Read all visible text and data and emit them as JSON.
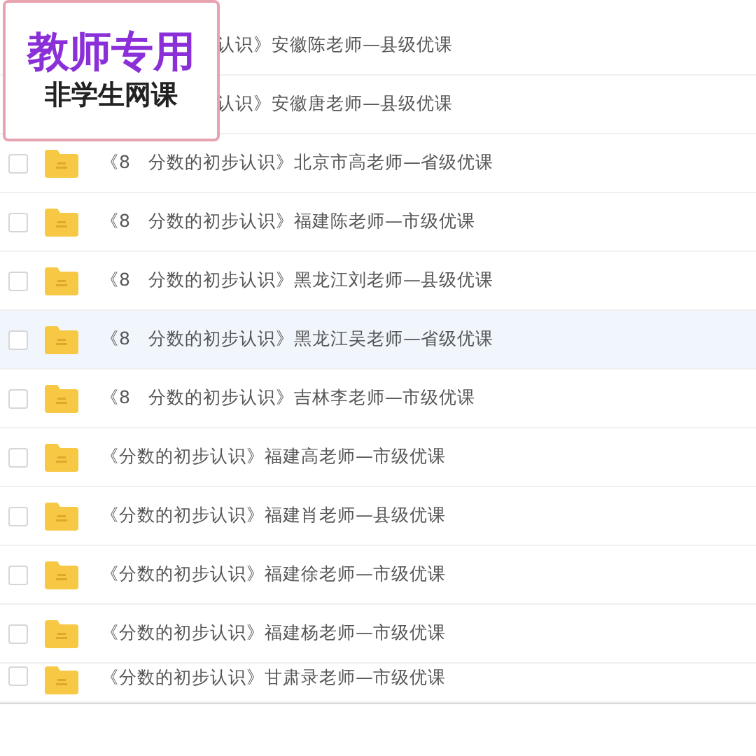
{
  "stamp": {
    "title": "教师专用",
    "subtitle": "非学生网课"
  },
  "files": [
    {
      "name": "认识》安徽陈老师—县级优课",
      "covered": true,
      "selected": false
    },
    {
      "name": "认识》安徽唐老师—县级优课",
      "covered": true,
      "selected": false
    },
    {
      "name": "《8　分数的初步认识》北京市高老师—省级优课",
      "covered": false,
      "selected": false
    },
    {
      "name": "《8　分数的初步认识》福建陈老师—市级优课",
      "covered": false,
      "selected": false
    },
    {
      "name": "《8　分数的初步认识》黑龙江刘老师—县级优课",
      "covered": false,
      "selected": false
    },
    {
      "name": "《8　分数的初步认识》黑龙江吴老师—省级优课",
      "covered": false,
      "selected": true
    },
    {
      "name": "《8　分数的初步认识》吉林李老师—市级优课",
      "covered": false,
      "selected": false
    },
    {
      "name": "《分数的初步认识》福建高老师—市级优课",
      "covered": false,
      "selected": false
    },
    {
      "name": "《分数的初步认识》福建肖老师—县级优课",
      "covered": false,
      "selected": false
    },
    {
      "name": "《分数的初步认识》福建徐老师—市级优课",
      "covered": false,
      "selected": false
    },
    {
      "name": "《分数的初步认识》福建杨老师—市级优课",
      "covered": false,
      "selected": false
    },
    {
      "name": "《分数的初步认识》甘肃录老师—市级优课",
      "covered": false,
      "selected": false
    }
  ]
}
